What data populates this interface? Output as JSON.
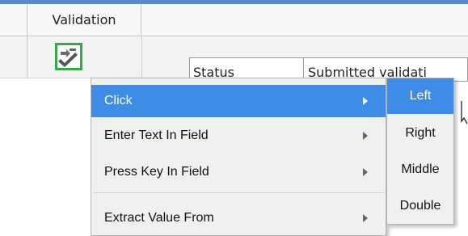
{
  "grid": {
    "header_validation": "Validation",
    "inner_columns": [
      "Status",
      "Submitted validati"
    ]
  },
  "context_menu": {
    "items": [
      {
        "label": "Click",
        "has_submenu": true,
        "highlighted": true
      },
      {
        "label": "Enter Text In Field",
        "has_submenu": true,
        "highlighted": false
      },
      {
        "label": "Press Key In Field",
        "has_submenu": true,
        "highlighted": false
      },
      {
        "label": "Extract Value From",
        "has_submenu": true,
        "highlighted": false
      }
    ]
  },
  "submenu": {
    "items": [
      {
        "label": "Left",
        "highlighted": true
      },
      {
        "label": "Right",
        "highlighted": false
      },
      {
        "label": "Middle",
        "highlighted": false
      },
      {
        "label": "Double",
        "highlighted": false
      }
    ]
  },
  "colors": {
    "highlight": "#3d8ce5",
    "icon_border": "#3aa64a",
    "top_bar": "#5b89c8"
  },
  "icons": [
    "validation-check-icon",
    "submenu-arrow-icon",
    "mouse-cursor-icon"
  ]
}
